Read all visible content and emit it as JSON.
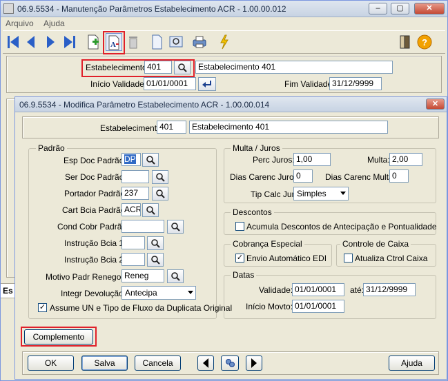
{
  "outer": {
    "title": "06.9.5534 - Manutenção Parâmetros Estabelecimento ACR - 1.00.00.012",
    "menu": [
      "Arquivo",
      "Ajuda"
    ],
    "estab_label": "Estabelecimento:",
    "estab_code": "401",
    "estab_name": "Estabelecimento 401",
    "inicio_label": "Início Validade:",
    "inicio_value": "01/01/0001",
    "fim_label": "Fim Validade:",
    "fim_value": "31/12/9999",
    "side_label": "Es"
  },
  "dialog": {
    "title": "06.9.5534 - Modifica Parâmetro Estabelecimento ACR - 1.00.00.014",
    "estab_label": "Estabelecimento:",
    "estab_code": "401",
    "estab_name": "Estabelecimento 401",
    "padrao": {
      "title": "Padrão",
      "esp_label": "Esp Doc Padrão:",
      "esp_value": "DP",
      "ser_label": "Ser Doc Padrão:",
      "ser_value": "",
      "portador_label": "Portador Padrão:",
      "portador_value": "237",
      "cart_label": "Cart Bcia Padrão:",
      "cart_value": "ACR",
      "cond_label": "Cond Cobr Padrão:",
      "cond_value": "",
      "instr1_label": "Instrução Bcia 1:",
      "instr1_value": "",
      "instr2_label": "Instrução Bcia 2:",
      "instr2_value": "",
      "motivo_label": "Motivo Padr Renegoc:",
      "motivo_value": "Reneg",
      "integr_label": "Integr Devolução:",
      "integr_value": "Antecipa",
      "assume_label": "Assume UN e Tipo de Fluxo da Duplicata Original",
      "assume_checked": "✓"
    },
    "multa": {
      "title": "Multa / Juros",
      "perc_label": "Perc Juros:",
      "perc_value": "1,00",
      "multa_label": "Multa:",
      "multa_value": "2,00",
      "dias_juros_label": "Dias Carenc Juros:",
      "dias_juros_value": "0",
      "dias_multa_label": "Dias Carenc Multa:",
      "dias_multa_value": "0",
      "tip_label": "Tip Calc Jur:",
      "tip_value": "Simples"
    },
    "descontos": {
      "title": "Descontos",
      "acumula_label": "Acumula Descontos de Antecipação e Pontualidade"
    },
    "cobranca": {
      "title": "Cobrança Especial",
      "envio_label": "Envio Automático EDI",
      "envio_checked": "✓"
    },
    "controle": {
      "title": "Controle de Caixa",
      "atualiza_label": "Atualiza Ctrol Caixa"
    },
    "datas": {
      "title": "Datas",
      "validade_label": "Validade:",
      "validade_from": "01/01/0001",
      "ate_label": "até:",
      "validade_to": "31/12/9999",
      "inicio_label": "Início Movto:",
      "inicio_value": "01/01/0001"
    },
    "complemento_label": "Complemento",
    "buttons": {
      "ok": "OK",
      "salva": "Salva",
      "cancela": "Cancela",
      "ajuda": "Ajuda"
    }
  }
}
